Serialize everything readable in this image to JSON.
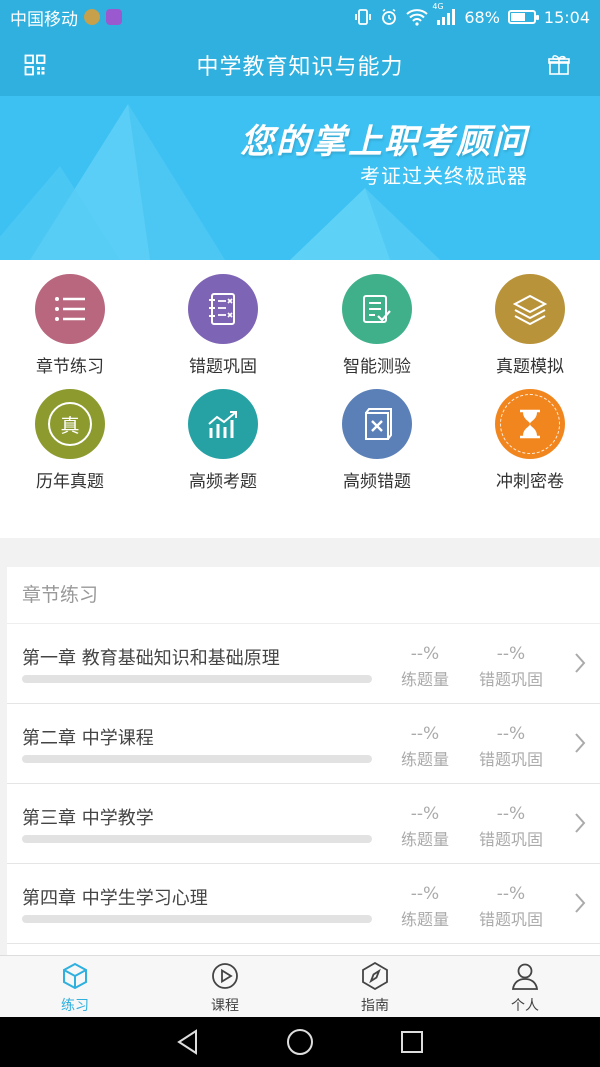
{
  "status_bar": {
    "carrier": "中国移动",
    "network": "4G",
    "battery": "68%",
    "battery_level": 0.68,
    "time": "15:04"
  },
  "header": {
    "title": "中学教育知识与能力",
    "left_icon": "grid-menu-icon",
    "right_icon": "gift-icon"
  },
  "banner": {
    "title": "您的掌上职考顾问",
    "subtitle": "考证过关终极武器"
  },
  "features": [
    {
      "label": "章节练习",
      "icon": "list-icon",
      "color": "#b8677e"
    },
    {
      "label": "错题巩固",
      "icon": "notebook-icon",
      "color": "#7e64b4"
    },
    {
      "label": "智能测验",
      "icon": "checklist-icon",
      "color": "#3fb08a"
    },
    {
      "label": "真题模拟",
      "icon": "layers-icon",
      "color": "#b8933a"
    },
    {
      "label": "历年真题",
      "icon": "zhen-badge-icon",
      "color": "#8d9a2e",
      "glyph": "真"
    },
    {
      "label": "高频考题",
      "icon": "trend-chart-icon",
      "color": "#27a2a4"
    },
    {
      "label": "高频错题",
      "icon": "wrong-book-icon",
      "color": "#5b80b8"
    },
    {
      "label": "冲刺密卷",
      "icon": "hourglass-icon",
      "color": "#f2861e"
    }
  ],
  "chapters": {
    "section_title": "章节练习",
    "stat_labels": {
      "practice": "练题量",
      "wrong": "错题巩固"
    },
    "items": [
      {
        "name": "第一章 教育基础知识和基础原理",
        "practice": "--%",
        "wrong": "--%",
        "progress": 0
      },
      {
        "name": "第二章 中学课程",
        "practice": "--%",
        "wrong": "--%",
        "progress": 0
      },
      {
        "name": "第三章 中学教学",
        "practice": "--%",
        "wrong": "--%",
        "progress": 0
      },
      {
        "name": "第四章 中学生学习心理",
        "practice": "--%",
        "wrong": "--%",
        "progress": 0
      }
    ]
  },
  "bottom_nav": [
    {
      "label": "练习",
      "icon": "cube-icon",
      "active": true
    },
    {
      "label": "课程",
      "icon": "play-icon",
      "active": false
    },
    {
      "label": "指南",
      "icon": "compass-icon",
      "active": false
    },
    {
      "label": "个人",
      "icon": "person-icon",
      "active": false
    }
  ],
  "colors": {
    "primary": "#2fb0de",
    "banner": "#3cc1f2"
  }
}
